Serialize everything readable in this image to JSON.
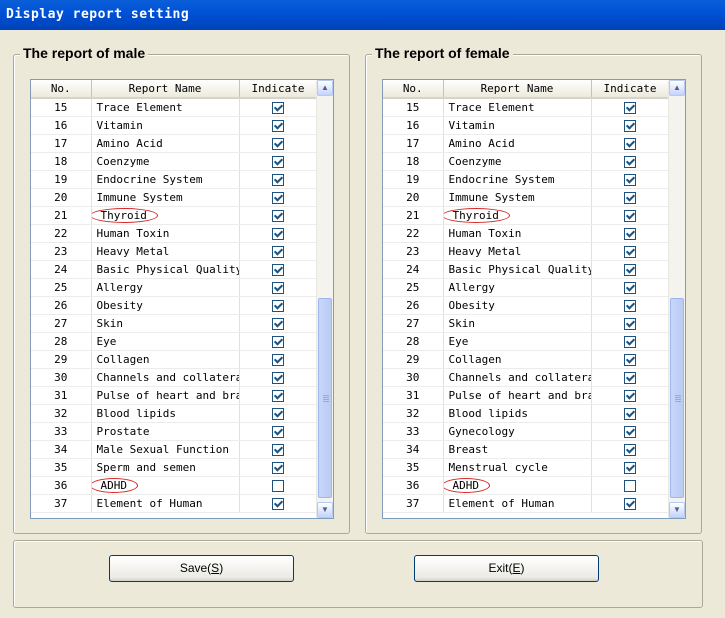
{
  "window": {
    "title": "Display report setting"
  },
  "columns": {
    "no": "No.",
    "name": "Report Name",
    "indicate": "Indicate"
  },
  "male": {
    "legend": "The report of male",
    "rows": [
      {
        "no": "15",
        "name": "Trace Element",
        "checked": true,
        "circled": false
      },
      {
        "no": "16",
        "name": "Vitamin",
        "checked": true,
        "circled": false
      },
      {
        "no": "17",
        "name": "Amino Acid",
        "checked": true,
        "circled": false
      },
      {
        "no": "18",
        "name": "Coenzyme",
        "checked": true,
        "circled": false
      },
      {
        "no": "19",
        "name": "Endocrine System",
        "checked": true,
        "circled": false
      },
      {
        "no": "20",
        "name": "Immune System",
        "checked": true,
        "circled": false
      },
      {
        "no": "21",
        "name": "Thyroid",
        "checked": true,
        "circled": true
      },
      {
        "no": "22",
        "name": "Human Toxin",
        "checked": true,
        "circled": false
      },
      {
        "no": "23",
        "name": "Heavy Metal",
        "checked": true,
        "circled": false
      },
      {
        "no": "24",
        "name": "Basic Physical Quality",
        "checked": true,
        "circled": false
      },
      {
        "no": "25",
        "name": "Allergy",
        "checked": true,
        "circled": false
      },
      {
        "no": "26",
        "name": "Obesity",
        "checked": true,
        "circled": false
      },
      {
        "no": "27",
        "name": "Skin",
        "checked": true,
        "circled": false
      },
      {
        "no": "28",
        "name": "Eye",
        "checked": true,
        "circled": false
      },
      {
        "no": "29",
        "name": "Collagen",
        "checked": true,
        "circled": false
      },
      {
        "no": "30",
        "name": "Channels and collateral:",
        "checked": true,
        "circled": false
      },
      {
        "no": "31",
        "name": "Pulse of heart and brai",
        "checked": true,
        "circled": false
      },
      {
        "no": "32",
        "name": "Blood lipids",
        "checked": true,
        "circled": false
      },
      {
        "no": "33",
        "name": "Prostate",
        "checked": true,
        "circled": false
      },
      {
        "no": "34",
        "name": "Male Sexual Function",
        "checked": true,
        "circled": false
      },
      {
        "no": "35",
        "name": "Sperm and semen",
        "checked": true,
        "circled": false
      },
      {
        "no": "36",
        "name": "ADHD",
        "checked": false,
        "circled": true
      },
      {
        "no": "37",
        "name": "Element of Human",
        "checked": true,
        "circled": false
      }
    ]
  },
  "female": {
    "legend": "The report of female",
    "rows": [
      {
        "no": "15",
        "name": "Trace Element",
        "checked": true,
        "circled": false
      },
      {
        "no": "16",
        "name": "Vitamin",
        "checked": true,
        "circled": false
      },
      {
        "no": "17",
        "name": "Amino Acid",
        "checked": true,
        "circled": false
      },
      {
        "no": "18",
        "name": "Coenzyme",
        "checked": true,
        "circled": false
      },
      {
        "no": "19",
        "name": "Endocrine System",
        "checked": true,
        "circled": false
      },
      {
        "no": "20",
        "name": "Immune System",
        "checked": true,
        "circled": false
      },
      {
        "no": "21",
        "name": "Thyroid",
        "checked": true,
        "circled": true
      },
      {
        "no": "22",
        "name": "Human Toxin",
        "checked": true,
        "circled": false
      },
      {
        "no": "23",
        "name": "Heavy Metal",
        "checked": true,
        "circled": false
      },
      {
        "no": "24",
        "name": "Basic Physical Quality",
        "checked": true,
        "circled": false
      },
      {
        "no": "25",
        "name": "Allergy",
        "checked": true,
        "circled": false
      },
      {
        "no": "26",
        "name": "Obesity",
        "checked": true,
        "circled": false
      },
      {
        "no": "27",
        "name": "Skin",
        "checked": true,
        "circled": false
      },
      {
        "no": "28",
        "name": "Eye",
        "checked": true,
        "circled": false
      },
      {
        "no": "29",
        "name": "Collagen",
        "checked": true,
        "circled": false
      },
      {
        "no": "30",
        "name": "Channels and collateral:",
        "checked": true,
        "circled": false
      },
      {
        "no": "31",
        "name": "Pulse of heart and brai",
        "checked": true,
        "circled": false
      },
      {
        "no": "32",
        "name": "Blood lipids",
        "checked": true,
        "circled": false
      },
      {
        "no": "33",
        "name": "Gynecology",
        "checked": true,
        "circled": false
      },
      {
        "no": "34",
        "name": "Breast",
        "checked": true,
        "circled": false
      },
      {
        "no": "35",
        "name": "Menstrual cycle",
        "checked": true,
        "circled": false
      },
      {
        "no": "36",
        "name": "ADHD",
        "checked": false,
        "circled": true
      },
      {
        "no": "37",
        "name": "Element of Human",
        "checked": true,
        "circled": false
      }
    ]
  },
  "buttons": {
    "save": {
      "text": "Save(",
      "key": "S",
      "end": ")"
    },
    "exit": {
      "text": "Exit(",
      "key": "E",
      "end": ")"
    }
  },
  "colors": {
    "titlebar": "#0051d6",
    "circle": "#d42a2a",
    "dialog": "#ece9d8"
  }
}
